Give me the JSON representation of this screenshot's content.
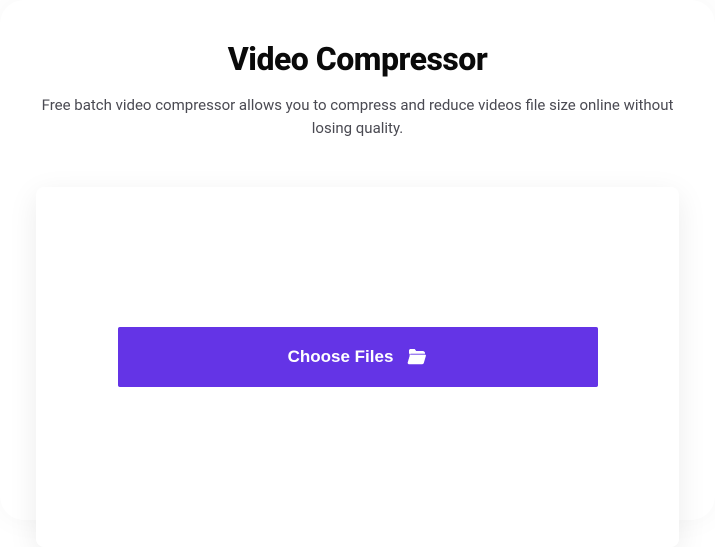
{
  "header": {
    "title": "Video Compressor",
    "subtitle": "Free batch video compressor allows you to compress and reduce videos file size online without losing quality."
  },
  "upload": {
    "button_label": "Choose Files",
    "icon": "folder-open-icon"
  },
  "colors": {
    "accent": "#6434e6",
    "text_primary": "#0a0a0a",
    "text_secondary": "#4a4a52"
  }
}
